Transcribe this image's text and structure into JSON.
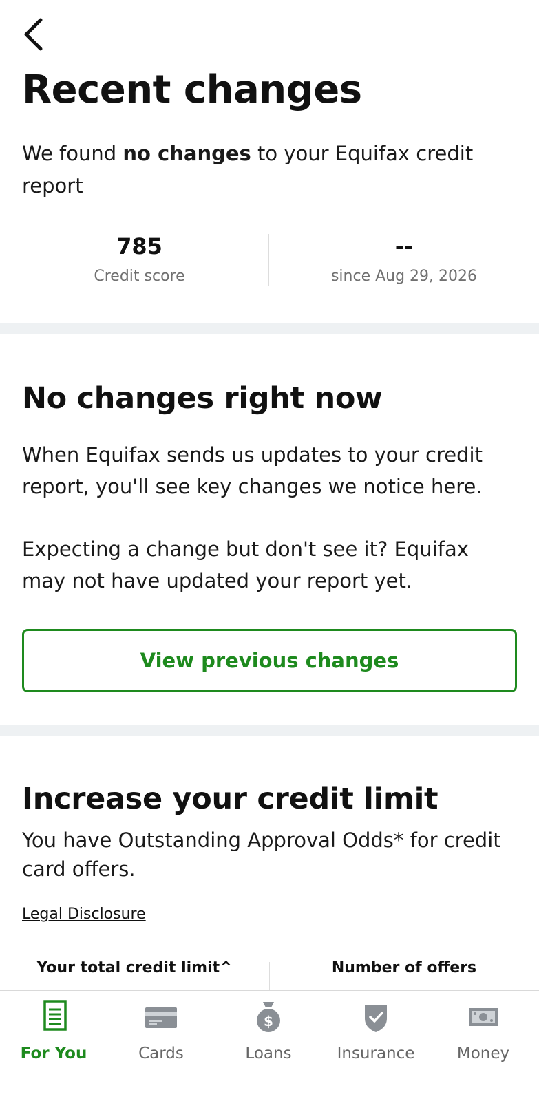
{
  "header": {
    "back_icon": "chevron-left-icon",
    "title": "Recent changes"
  },
  "intro": {
    "prefix": "We found ",
    "emphasis": "no changes",
    "suffix": " to your Equifax credit report"
  },
  "stats": {
    "score": {
      "value": "785",
      "label": "Credit score"
    },
    "change": {
      "value": "--",
      "label": "since Aug 29, 2026"
    }
  },
  "no_changes": {
    "title": "No changes right now",
    "para1": "When Equifax sends us updates to your credit report, you'll see key changes we notice here.",
    "para2": "Expecting a change but don't see it? Equifax may not have updated your report yet.",
    "button": "View previous changes"
  },
  "increase_limit": {
    "title": "Increase your credit limit",
    "subtitle": "You have Outstanding Approval Odds* for credit card offers.",
    "link": "Legal Disclosure",
    "col_left": "Your total credit limit^",
    "col_right": "Number of offers"
  },
  "nav": {
    "items": [
      {
        "label": "For You",
        "icon": "document-icon",
        "active": true
      },
      {
        "label": "Cards",
        "icon": "card-icon",
        "active": false
      },
      {
        "label": "Loans",
        "icon": "money-bag-icon",
        "active": false
      },
      {
        "label": "Insurance",
        "icon": "shield-check-icon",
        "active": false
      },
      {
        "label": "Money",
        "icon": "banknote-icon",
        "active": false
      }
    ]
  },
  "colors": {
    "accent": "#1e8a1e",
    "muted": "#666666",
    "band": "#eef1f3"
  }
}
